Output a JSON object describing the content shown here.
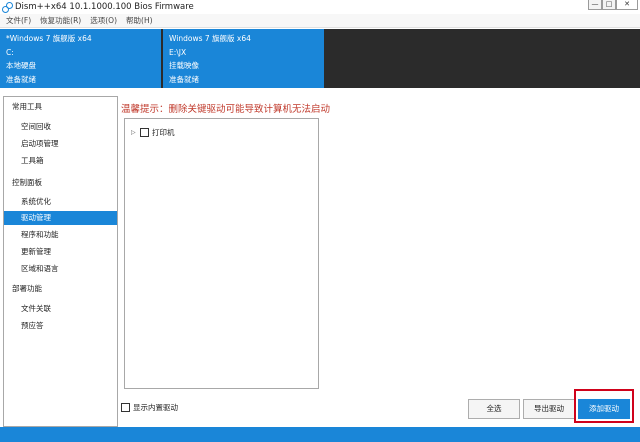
{
  "window": {
    "title": "Dism++x64 10.1.1000.100 Bios Firmware",
    "minimize_glyph": "—",
    "maximize_glyph": "□",
    "close_glyph": "✕"
  },
  "menu": [
    "文件(F)",
    "恢复功能(R)",
    "选项(O)",
    "帮助(H)"
  ],
  "sessions": [
    {
      "os": "*Windows 7 旗舰版 x64",
      "drive": "C:",
      "type": "本地硬盘",
      "status": "准备就绪"
    },
    {
      "os": "Windows 7 旗舰版 x64",
      "drive": "E:\\JX",
      "type": "挂载映像",
      "status": "准备就绪"
    }
  ],
  "sidebar": {
    "groups": [
      {
        "label": "常用工具",
        "items": [
          "空间回收",
          "启动项管理",
          "工具箱"
        ]
      },
      {
        "label": "控制面板",
        "items": [
          "系统优化",
          "驱动管理",
          "程序和功能",
          "更新管理",
          "区域和语言"
        ]
      },
      {
        "label": "部署功能",
        "items": [
          "文件关联",
          "预应答"
        ]
      }
    ],
    "selected": "驱动管理"
  },
  "main": {
    "warning": "温馨提示：删除关键驱动可能导致计算机无法启动",
    "tree": [
      {
        "label": "打印机",
        "checked": false,
        "expanded": false
      }
    ],
    "show_builtin_label": "显示内置驱动",
    "show_builtin_checked": false,
    "buttons": {
      "select_all": "全选",
      "export": "导出驱动",
      "add": "添加驱动"
    }
  },
  "colors": {
    "accent": "#1a86d8",
    "warning": "#c0392b",
    "highlight": "#d0021b",
    "session_bg": "#2b2b2b"
  }
}
